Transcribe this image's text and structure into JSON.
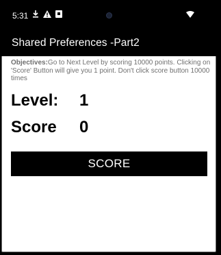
{
  "status_bar": {
    "time": "5:31",
    "icons": [
      "download-icon",
      "warning-icon",
      "app-notification-icon",
      "front-camera",
      "wifi-icon"
    ]
  },
  "app_bar": {
    "title": "Shared Preferences -Part2"
  },
  "objectives": {
    "label": "Objectives:",
    "text": "Go to Next Level by scoring 10000 points. Clicking on 'Score' Button will give you 1 point. Don't click score button 10000 times"
  },
  "level": {
    "label": "Level:",
    "value": "1"
  },
  "score": {
    "label": "Score",
    "value": "0"
  },
  "score_button": {
    "label": "SCORE"
  },
  "colors": {
    "background": "#000000",
    "content": "#ffffff",
    "objectives_text": "#6f6f6f",
    "button": "#000000"
  }
}
